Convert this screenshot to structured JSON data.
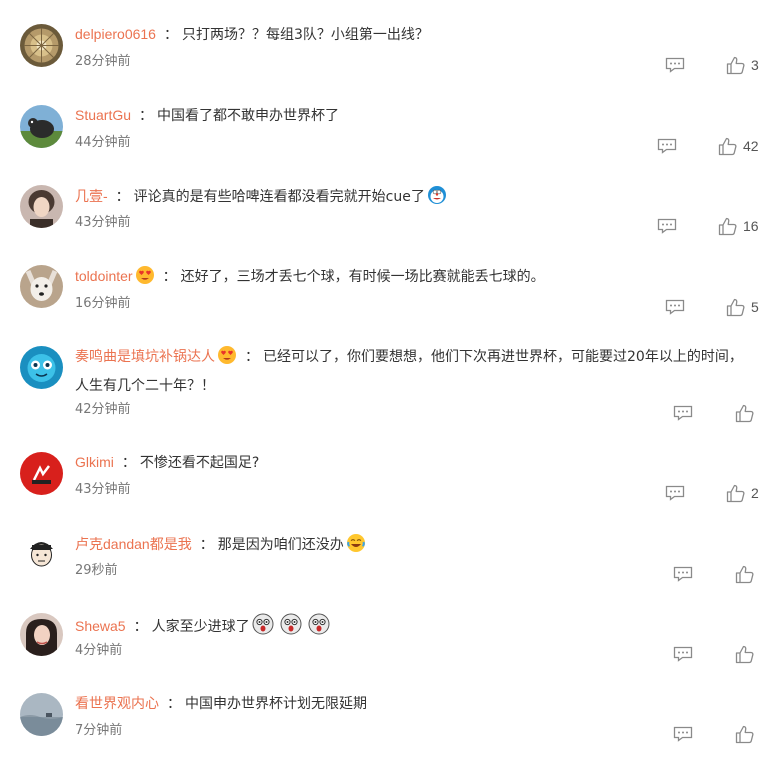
{
  "comments": [
    {
      "username": "delpiero0616",
      "text": "只打两场？？每组3队？小组第一出线？",
      "time": "28分钟前",
      "likes": "3",
      "badge": "",
      "emoji_after": []
    },
    {
      "username": "StuartGu",
      "text": "中国看了都不敢申办世界杯了",
      "time": "44分钟前",
      "likes": "42",
      "badge": "",
      "emoji_after": []
    },
    {
      "username": "几壹-",
      "text": "评论真的是有些哈啤连看都没看完就开始cue了",
      "time": "43分钟前",
      "likes": "16",
      "badge": "",
      "emoji_after": [
        "doraemon-emoji"
      ]
    },
    {
      "username": "toldointer",
      "text": "还好了，三场才丢七个球，有时候一场比赛就能丢七球的。",
      "time": "16分钟前",
      "likes": "5",
      "badge": "heart-face-badge",
      "emoji_after": []
    },
    {
      "username": "奏鸣曲是填坑补锅达人",
      "text": "已经可以了，你们要想想，他们下次再进世界杯，可能要过20年以上的时间，人生有几个二十年？！",
      "time": "42分钟前",
      "likes": "",
      "badge": "heart-face-badge",
      "emoji_after": []
    },
    {
      "username": "Glkimi",
      "text": "不惨还看不起国足?",
      "time": "43分钟前",
      "likes": "2",
      "badge": "",
      "emoji_after": []
    },
    {
      "username": "卢克dandan都是我",
      "text": "那是因为咱们还没办",
      "time": "29秒前",
      "likes": "",
      "badge": "",
      "emoji_after": [
        "laugh-cry-emoji"
      ]
    },
    {
      "username": "Shewa5",
      "text": "人家至少进球了",
      "time": "4分钟前",
      "likes": "",
      "badge": "",
      "emoji_after": [
        "shocked-face-emoji",
        "shocked-face-emoji",
        "shocked-face-emoji"
      ]
    },
    {
      "username": "看世界观内心",
      "text": "中国申办世界杯计划无限延期",
      "time": "7分钟前",
      "likes": "",
      "badge": "",
      "emoji_after": []
    }
  ],
  "separator": "：",
  "colors": {
    "username": "#eb7350",
    "text": "#333333",
    "meta": "#777777",
    "icon": "#8a8a8a"
  }
}
